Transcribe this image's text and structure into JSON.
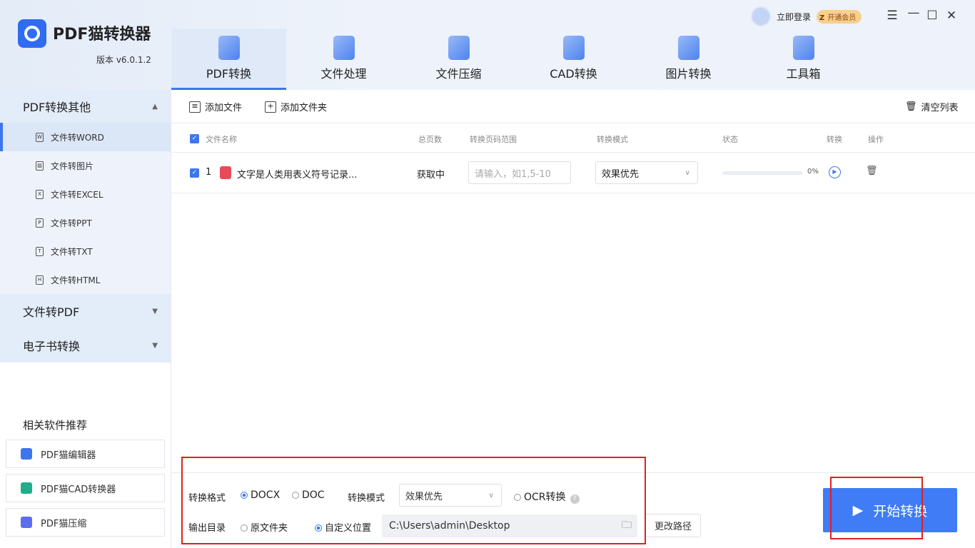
{
  "app": {
    "title": "PDF猫转换器",
    "version": "版本 v6.0.1.2"
  },
  "tabs": [
    {
      "label": "PDF转换",
      "active": true
    },
    {
      "label": "文件处理"
    },
    {
      "label": "文件压缩"
    },
    {
      "label": "CAD转换"
    },
    {
      "label": "图片转换"
    },
    {
      "label": "工具箱"
    }
  ],
  "user": {
    "login": "立即登录",
    "vip": "开通会员",
    "vip_badge": "Z"
  },
  "window": {
    "menu": "☰",
    "minimize": "—",
    "maximize": "☐",
    "close": "✕"
  },
  "sidebar": {
    "sections": [
      {
        "label": "PDF转换其他",
        "expanded": true,
        "items": [
          {
            "label": "文件转WORD",
            "icon": "W",
            "selected": true
          },
          {
            "label": "文件转图片",
            "icon": "▨"
          },
          {
            "label": "文件转EXCEL",
            "icon": "X"
          },
          {
            "label": "文件转PPT",
            "icon": "P"
          },
          {
            "label": "文件转TXT",
            "icon": "T"
          },
          {
            "label": "文件转HTML",
            "icon": "H"
          }
        ]
      },
      {
        "label": "文件转PDF"
      },
      {
        "label": "电子书转换"
      }
    ],
    "recommend_title": "相关软件推荐",
    "recommend": [
      {
        "label": "PDF猫编辑器",
        "color": "#3d76ee"
      },
      {
        "label": "PDF猫CAD转换器",
        "color": "#1fae8c"
      },
      {
        "label": "PDF猫压缩",
        "color": "#5b6ef0"
      }
    ]
  },
  "toolbar": {
    "add_file": "添加文件",
    "add_folder": "添加文件夹",
    "clear": "清空列表"
  },
  "table": {
    "headers": [
      "文件名称",
      "总页数",
      "转换页码范围",
      "转换模式",
      "状态",
      "转换",
      "操作"
    ],
    "rows": [
      {
        "index": "1",
        "name": "文字是人类用表义符号记录...",
        "pages": "获取中",
        "range_placeholder": "请输入，如1,5-10",
        "mode": "效果优先",
        "progress": 0,
        "progress_text": "0%"
      }
    ]
  },
  "bottom": {
    "format_label": "转换格式",
    "formats": [
      "DOCX",
      "DOC"
    ],
    "format_selected": "DOCX",
    "mode_label": "转换模式",
    "mode_value": "效果优先",
    "ocr": "OCR转换",
    "output_label": "输出目录",
    "out_options": [
      "原文件夹",
      "自定义位置"
    ],
    "out_selected": "自定义位置",
    "path": "C:\\Users\\admin\\Desktop",
    "change_path": "更改路径",
    "start": "开始转换"
  },
  "colors": {
    "accent": "#3f7cf5",
    "highlight": "#e02020"
  }
}
